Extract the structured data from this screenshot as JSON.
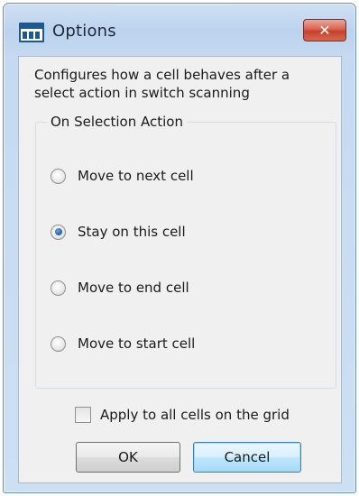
{
  "window": {
    "title": "Options",
    "close_label": "✕"
  },
  "description": "Configures how a cell behaves after a select action in switch scanning",
  "group": {
    "legend": "On Selection Action",
    "options": [
      {
        "label": "Move to next cell",
        "checked": false
      },
      {
        "label": "Stay on this cell",
        "checked": true
      },
      {
        "label": "Move to end cell",
        "checked": false
      },
      {
        "label": "Move to start cell",
        "checked": false
      }
    ]
  },
  "apply_all": {
    "label": "Apply to all cells on the grid",
    "checked": false
  },
  "buttons": {
    "ok": "OK",
    "cancel": "Cancel"
  },
  "colors": {
    "title_bar": "#bcd3ee",
    "close_button": "#c6412c",
    "radio_selected": "#1b5fa5",
    "default_button": "#bee6fd"
  }
}
